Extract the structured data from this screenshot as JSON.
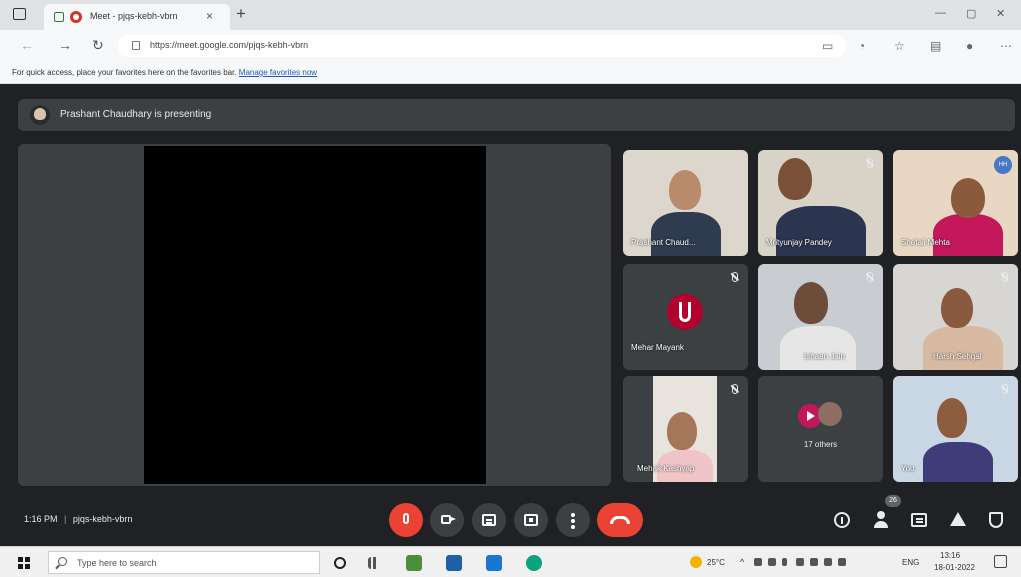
{
  "browser": {
    "tab_title": "Meet - pjqs-kebh-vbrn",
    "tab_close": "×",
    "new_tab": "+",
    "window_minimize": "—",
    "window_maximize": "▢",
    "window_close": "✕",
    "back": "←",
    "forward": "→",
    "reload": "↻",
    "url": "https://meet.google.com/pjqs-kebh-vbrn",
    "favorites_prompt": "For quick access, place your favorites here on the favorites bar.",
    "favorites_link": "Manage favorites now"
  },
  "meet": {
    "presenting_text": "Prashant Chaudhary is presenting",
    "tiles": [
      {
        "name": "Prashant Chaud..."
      },
      {
        "name": "Mrityunjay Pandey"
      },
      {
        "name": "Shefali Mehta"
      },
      {
        "name": "Mehar Mayank"
      },
      {
        "name": "Ishaan Jain"
      },
      {
        "name": "Harsh Sehgal"
      },
      {
        "name": "Mehak Kashyap"
      },
      {
        "name": "17 others"
      },
      {
        "name": "You"
      }
    ],
    "tile_badge": "HH",
    "time": "1:16 PM",
    "separator": "|",
    "meeting_code": "pjqs-kebh-vbrn",
    "people_count": "26"
  },
  "taskbar": {
    "search_placeholder": "Type here to search",
    "weather": "25°C",
    "language": "ENG",
    "clock_time": "13:16",
    "clock_date": "18-01-2022"
  },
  "colors": {
    "meet_background": "#202124",
    "tile_background": "#3c4043",
    "hangup_red": "#ea4335",
    "link_blue": "#1a5fb4"
  }
}
